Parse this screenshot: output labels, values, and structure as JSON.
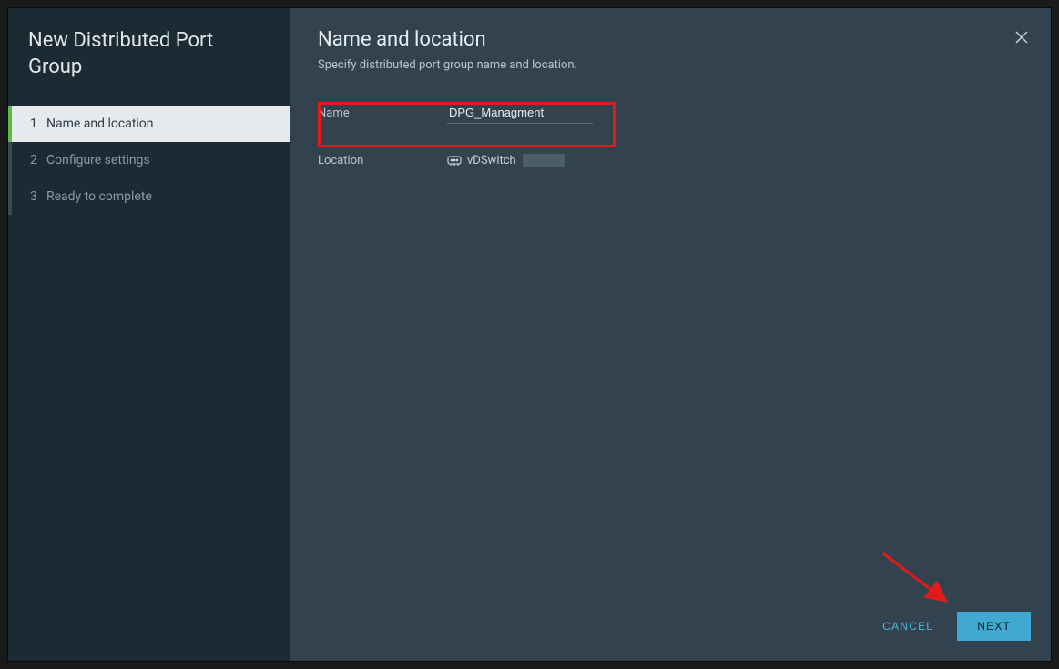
{
  "wizard": {
    "title": "New Distributed Port Group",
    "steps": [
      {
        "number": "1",
        "label": "Name and location",
        "active": true
      },
      {
        "number": "2",
        "label": "Configure settings",
        "active": false
      },
      {
        "number": "3",
        "label": "Ready to complete",
        "active": false
      }
    ]
  },
  "main": {
    "title": "Name and location",
    "subtitle": "Specify distributed port group name and location."
  },
  "form": {
    "name_label": "Name",
    "name_value": "DPG_Managment",
    "location_label": "Location",
    "location_value": "vDSwitch"
  },
  "footer": {
    "cancel": "CANCEL",
    "next": "NEXT"
  }
}
